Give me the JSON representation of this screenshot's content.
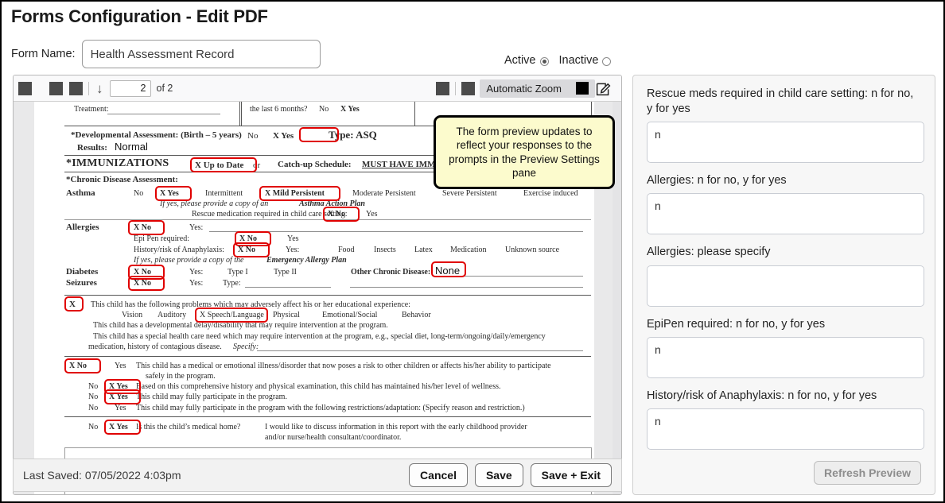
{
  "header": {
    "title": "Forms Configuration - Edit PDF",
    "form_name_label": "Form Name:",
    "form_name_value": "Health Assessment Record",
    "status": {
      "active_label": "Active",
      "inactive_label": "Inactive",
      "selected": "Active"
    }
  },
  "pdf_toolbar": {
    "sidebar_toggle_icon": "sidebar-toggle-icon",
    "zoom_out_icon": "zoom-out-icon",
    "zoom_in_icon": "zoom-in-icon",
    "page_down_icon": "arrow-down-icon",
    "page_number": "2",
    "page_of": "of 2",
    "print_icon": "print-icon",
    "download_icon": "download-icon",
    "zoom_level": "Automatic Zoom",
    "zoom_caret_icon": "chevron-down-icon",
    "tools_icon": "edit-document-icon"
  },
  "callout": {
    "text": "The form preview updates to reflect your responses to the prompts in the Preview Settings pane"
  },
  "document": {
    "lines": [
      {
        "id": "treatment",
        "text": "Treatment:"
      },
      {
        "id": "last6months",
        "text": "the last 6 months?"
      },
      {
        "id": "last6months_no",
        "text": "No"
      },
      {
        "id": "last6months_yes",
        "text": "X Yes"
      },
      {
        "id": "dev_assessment",
        "text": "*Developmental Assessment: (Birth – 5 years)"
      },
      {
        "id": "dev_no",
        "text": "No"
      },
      {
        "id": "dev_yes",
        "text": "X  Yes"
      },
      {
        "id": "dev_type",
        "text": "Type: ASQ"
      },
      {
        "id": "results",
        "text": "Results:"
      },
      {
        "id": "results_value",
        "text": "Normal"
      },
      {
        "id": "immunizations",
        "text": "*IMMUNIZATIONS"
      },
      {
        "id": "imm_uptodate",
        "text": "X  Up to Date"
      },
      {
        "id": "imm_or",
        "text": "or"
      },
      {
        "id": "catchup_label",
        "text": "Catch-up Schedule:"
      },
      {
        "id": "catchup_value",
        "text": "MUST HAVE IMMUNIZ"
      },
      {
        "id": "chronic_header",
        "text": "*Chronic Disease Assessment:"
      },
      {
        "id": "asthma",
        "text": "Asthma"
      },
      {
        "id": "asthma_no",
        "text": "No"
      },
      {
        "id": "asthma_yes",
        "text": "X  Yes"
      },
      {
        "id": "asthma_intermittent",
        "text": "Intermittent"
      },
      {
        "id": "asthma_mild",
        "text": "X  Mild Persistent"
      },
      {
        "id": "asthma_moderate",
        "text": "Moderate Persistent"
      },
      {
        "id": "asthma_severe",
        "text": "Severe Persistent"
      },
      {
        "id": "asthma_exercise",
        "text": "Exercise induced"
      },
      {
        "id": "asthma_note",
        "text": "If yes, please provide a copy of an "
      },
      {
        "id": "asthma_note_b",
        "text": "Asthma Action Plan"
      },
      {
        "id": "rescue_label",
        "text": "Rescue medication required in child care setting:"
      },
      {
        "id": "rescue_no",
        "text": "X  No"
      },
      {
        "id": "rescue_yes",
        "text": "Yes"
      },
      {
        "id": "allergies",
        "text": "Allergies"
      },
      {
        "id": "allergies_no",
        "text": "X  No"
      },
      {
        "id": "allergies_yes",
        "text": "Yes:"
      },
      {
        "id": "epipen_label",
        "text": "Epi Pen required:"
      },
      {
        "id": "epipen_no",
        "text": "X  No"
      },
      {
        "id": "epipen_yes",
        "text": "Yes"
      },
      {
        "id": "anaphylaxis_label",
        "text": "History/risk of Anaphylaxis:"
      },
      {
        "id": "anaphylaxis_no",
        "text": "X  No"
      },
      {
        "id": "anaphylaxis_yes",
        "text": "Yes:"
      },
      {
        "id": "ana_food",
        "text": "Food"
      },
      {
        "id": "ana_insects",
        "text": "Insects"
      },
      {
        "id": "ana_latex",
        "text": "Latex"
      },
      {
        "id": "ana_medication",
        "text": "Medication"
      },
      {
        "id": "ana_unknown",
        "text": "Unknown source"
      },
      {
        "id": "allergy_note",
        "text": "If yes, please provide a copy of the "
      },
      {
        "id": "allergy_note_b",
        "text": "Emergency Allergy Plan"
      },
      {
        "id": "diabetes",
        "text": "Diabetes"
      },
      {
        "id": "diabetes_no",
        "text": "X  No"
      },
      {
        "id": "diabetes_yes",
        "text": "Yes:"
      },
      {
        "id": "diabetes_type1",
        "text": "Type I"
      },
      {
        "id": "diabetes_type2",
        "text": "Type II"
      },
      {
        "id": "other_chronic_label",
        "text": "Other Chronic Disease:"
      },
      {
        "id": "other_chronic_value",
        "text": "None"
      },
      {
        "id": "seizures",
        "text": "Seizures"
      },
      {
        "id": "seizures_no",
        "text": "X  No"
      },
      {
        "id": "seizures_yes",
        "text": "Yes:"
      },
      {
        "id": "seizures_type",
        "text": "Type:"
      },
      {
        "id": "prob_x",
        "text": "X"
      },
      {
        "id": "prob_text",
        "text": "This child has the following problems which may adversely affect his or her educational experience:"
      },
      {
        "id": "prob_vision",
        "text": "Vision"
      },
      {
        "id": "prob_auditory",
        "text": "Auditory"
      },
      {
        "id": "prob_speech",
        "text": "X  Speech/Language"
      },
      {
        "id": "prob_physical",
        "text": "Physical"
      },
      {
        "id": "prob_emotional",
        "text": "Emotional/Social"
      },
      {
        "id": "prob_behavior",
        "text": "Behavior"
      },
      {
        "id": "delay_text",
        "text": "This child has a developmental delay/disability that may require intervention at the program."
      },
      {
        "id": "special_text",
        "text": "This child has a special health care need which may require intervention at the program, e.g., special diet, long-term/ongoing/daily/emergency"
      },
      {
        "id": "special_text2",
        "text": "medication, history of contagious disease. "
      },
      {
        "id": "special_specify",
        "text": "Specify:"
      },
      {
        "id": "illness_no",
        "text": "X  No"
      },
      {
        "id": "illness_yes",
        "text": "Yes"
      },
      {
        "id": "illness_text",
        "text": "This child has a medical or emotional illness/disorder that now poses a risk to other children or affects his/her ability to participate"
      },
      {
        "id": "illness_text2",
        "text": "safely in the program."
      },
      {
        "id": "wellness_no",
        "text": "No"
      },
      {
        "id": "wellness_yes",
        "text": "X  Yes"
      },
      {
        "id": "wellness_text",
        "text": "Based on this comprehensive history and physical examination, this child has maintained his/her level of wellness."
      },
      {
        "id": "participate_no",
        "text": "No"
      },
      {
        "id": "participate_yes",
        "text": "X  Yes"
      },
      {
        "id": "participate_text",
        "text": "This child may fully participate in the program."
      },
      {
        "id": "restrict_no",
        "text": "No"
      },
      {
        "id": "restrict_yes",
        "text": "Yes"
      },
      {
        "id": "restrict_text",
        "text": "This child may fully participate in the program with the following restrictions/adaptation: (Specify reason and restriction.)"
      },
      {
        "id": "medhome_no",
        "text": "No"
      },
      {
        "id": "medhome_yes",
        "text": "X  Yes"
      },
      {
        "id": "medhome_text",
        "text": "Is this the child’s medical home?"
      },
      {
        "id": "discuss_text",
        "text": "I would like to discuss information in this report with the early childhood provider"
      },
      {
        "id": "discuss_text2",
        "text": "and/or nurse/health consultant/coordinator."
      }
    ]
  },
  "footer": {
    "last_saved": "Last Saved: 07/05/2022 4:03pm",
    "cancel_label": "Cancel",
    "save_label": "Save",
    "save_exit_label": "Save + Exit"
  },
  "settings_pane": {
    "fields": [
      {
        "label": "Rescue meds required in child care setting: n for no, y for yes",
        "value": "n"
      },
      {
        "label": "Allergies: n for no, y for yes",
        "value": "n"
      },
      {
        "label": "Allergies: please specify",
        "value": ""
      },
      {
        "label": "EpiPen required: n for no, y for yes",
        "value": "n"
      },
      {
        "label": "History/risk of Anaphylaxis: n for no, y for yes",
        "value": "n"
      }
    ],
    "refresh_label": "Refresh Preview"
  },
  "colors": {
    "highlight": "#e00000",
    "callout_bg": "#fcfbcd",
    "toolbar_bg": "#f9f9fa"
  }
}
